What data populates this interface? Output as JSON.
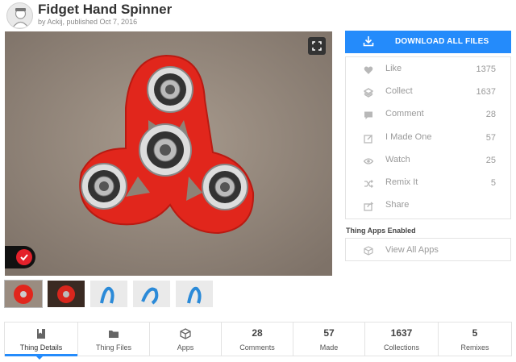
{
  "header": {
    "title": "Fidget Hand Spinner",
    "byline": "by Ackij, published Oct 7, 2016"
  },
  "sidebar": {
    "download_label": "DOWNLOAD ALL FILES",
    "actions": [
      {
        "label": "Like",
        "count": "1375",
        "icon": "heart-icon"
      },
      {
        "label": "Collect",
        "count": "1637",
        "icon": "collect-icon"
      },
      {
        "label": "Comment",
        "count": "28",
        "icon": "comment-icon"
      },
      {
        "label": "I Made One",
        "count": "57",
        "icon": "made-icon"
      },
      {
        "label": "Watch",
        "count": "25",
        "icon": "eye-icon"
      },
      {
        "label": "Remix It",
        "count": "5",
        "icon": "remix-icon"
      },
      {
        "label": "Share",
        "count": "",
        "icon": "share-icon"
      }
    ],
    "apps_heading": "Thing Apps Enabled",
    "apps_link": "View All Apps"
  },
  "tabs": [
    {
      "label": "Thing Details",
      "count": "",
      "icon": "details-icon"
    },
    {
      "label": "Thing Files",
      "count": "",
      "icon": "folder-icon"
    },
    {
      "label": "Apps",
      "count": "",
      "icon": "cube-icon"
    },
    {
      "label": "Comments",
      "count": "28"
    },
    {
      "label": "Made",
      "count": "57"
    },
    {
      "label": "Collections",
      "count": "1637"
    },
    {
      "label": "Remixes",
      "count": "5"
    }
  ],
  "colors": {
    "accent": "#248bfb",
    "spinner_red": "#e1261c",
    "badge_red": "#e4212b"
  }
}
